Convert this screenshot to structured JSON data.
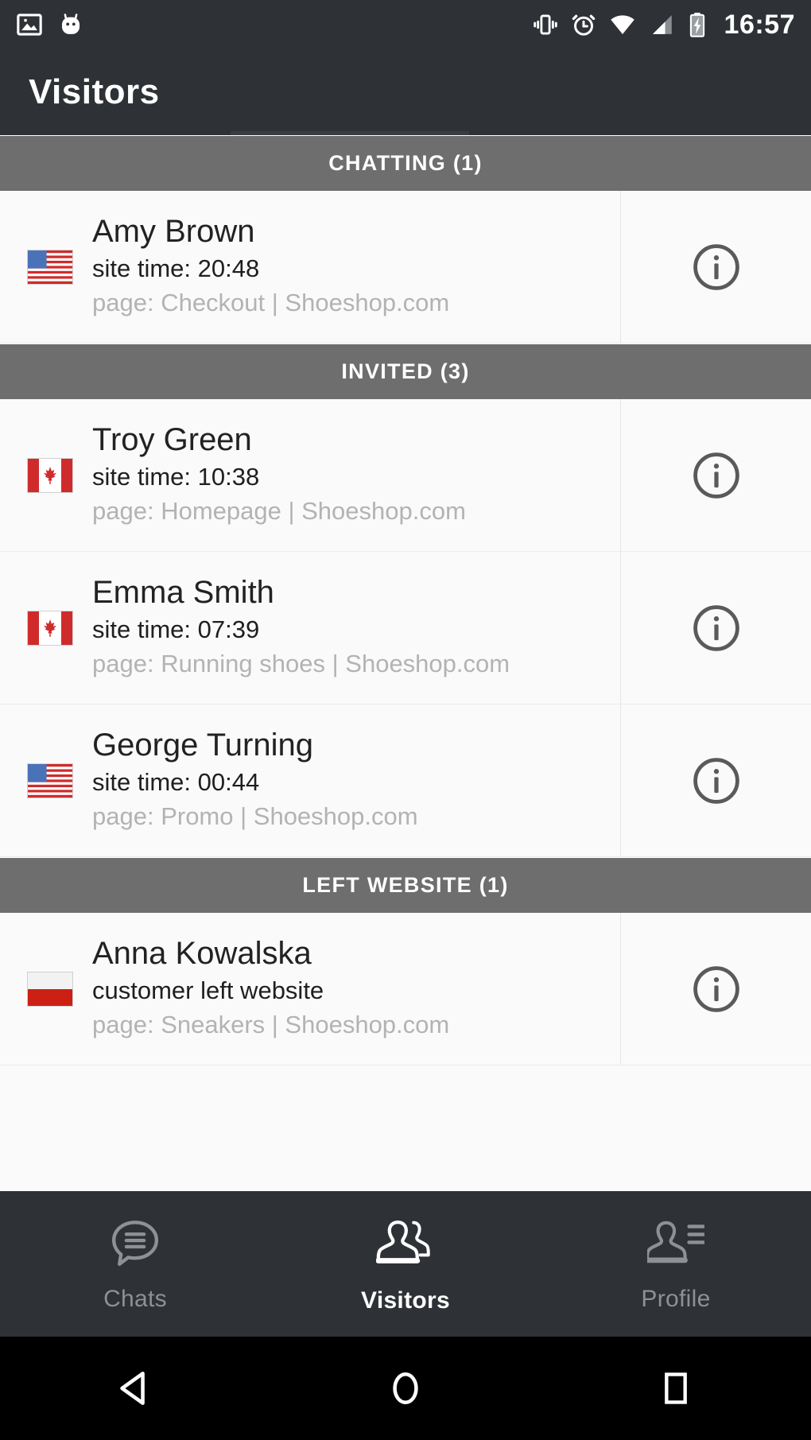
{
  "statusbar": {
    "time": "16:57",
    "left_icons": [
      "photo-icon",
      "robot-icon"
    ],
    "right_icons": [
      "vibrate-icon",
      "alarm-icon",
      "wifi-icon",
      "signal-icon",
      "battery-charging-icon"
    ]
  },
  "appbar": {
    "title": "Visitors"
  },
  "sections": [
    {
      "header": "CHATTING (1)",
      "rows": [
        {
          "flag": "us-flag",
          "name": "Amy Brown",
          "sub": "site time: 20:48",
          "page": "page: Checkout | Shoeshop.com",
          "info": "info-icon"
        }
      ]
    },
    {
      "header": "INVITED (3)",
      "rows": [
        {
          "flag": "ca-flag",
          "name": "Troy Green",
          "sub": "site time: 10:38",
          "page": "page: Homepage | Shoeshop.com",
          "info": "info-icon"
        },
        {
          "flag": "ca-flag",
          "name": "Emma Smith",
          "sub": "site time: 07:39",
          "page": "page: Running shoes | Shoeshop.com",
          "info": "info-icon"
        },
        {
          "flag": "us-flag",
          "name": "George Turning",
          "sub": "site time: 00:44",
          "page": "page: Promo | Shoeshop.com",
          "info": "info-icon"
        }
      ]
    },
    {
      "header": "LEFT WEBSITE (1)",
      "rows": [
        {
          "flag": "pl-flag",
          "name": "Anna Kowalska",
          "sub": "customer left website",
          "page": "page: Sneakers | Shoeshop.com",
          "info": "info-icon"
        }
      ]
    }
  ],
  "bottomnav": {
    "items": [
      {
        "label": "Chats",
        "icon": "chat-bubble-icon",
        "active": false
      },
      {
        "label": "Visitors",
        "icon": "people-icon",
        "active": true
      },
      {
        "label": "Profile",
        "icon": "profile-icon",
        "active": false
      }
    ]
  },
  "sysnav": {
    "buttons": [
      "back-icon",
      "home-icon",
      "recents-icon"
    ]
  },
  "colors": {
    "appbar_bg": "#2e3136",
    "section_header_bg": "#6e6e6e",
    "list_bg": "#fafafa",
    "name_text": "#222222",
    "page_text": "#b3b3b3",
    "nav_inactive": "#8d9095",
    "nav_active": "#ffffff"
  }
}
